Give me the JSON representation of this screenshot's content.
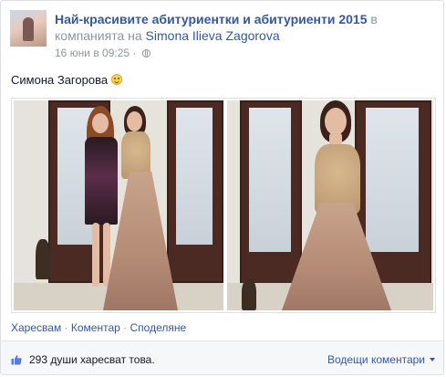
{
  "post": {
    "group_name": "Най-красивите абитуриентки и абитуриенти 2015",
    "connector": "в компанията на",
    "tagged_user": "Simona Ilieva Zagorova",
    "timestamp": "16 юни в 09:25",
    "privacy_icon": "globe-icon",
    "caption": "Симона Загорова",
    "emoji_icon": "smile-icon"
  },
  "actions": {
    "like": "Харесвам",
    "comment": "Коментар",
    "share": "Споделяне",
    "separator": "·"
  },
  "footer": {
    "like_icon": "thumbs-up-icon",
    "likes_count": "293",
    "likes_text": "души харесват това.",
    "sort_label": "Водещи коментари",
    "sort_icon": "caret-down-icon"
  },
  "colors": {
    "link": "#365899",
    "meta": "#90949c",
    "text": "#141823",
    "footer_bg": "#f6f7f9"
  }
}
